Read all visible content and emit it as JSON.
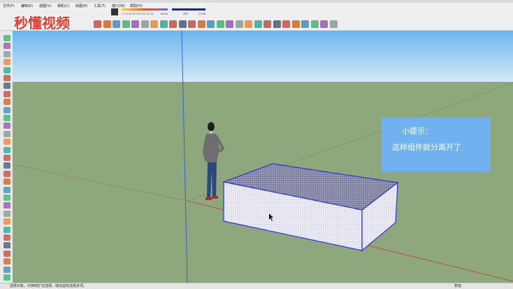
{
  "menu": [
    {
      "label": "文件(F)"
    },
    {
      "label": "编辑(E)"
    },
    {
      "label": "视图(V)"
    },
    {
      "label": "相机(C)"
    },
    {
      "label": "绘图(R)"
    },
    {
      "label": "工具(T)"
    },
    {
      "label": "窗口(W)"
    },
    {
      "label": "帮助(H)"
    }
  ],
  "shadow_bar": {
    "months": "1 2 3 4 5 6 7 8 9 10 11 12",
    "time_start": "06:00",
    "time_mid": "中午",
    "time_end": "17:00"
  },
  "watermark": {
    "text": "秒懂视频"
  },
  "tip": {
    "title": "小提示：",
    "body": "这样组件就分离开了"
  },
  "status": {
    "left": "选择对象。切换到扩充选择。拖动鼠标选择多项。",
    "right": "数值"
  },
  "colors": {
    "sky_top": "#6cb6ec",
    "sky_bottom": "#d4e8f7",
    "ground": "#8fa77c",
    "tip_bg": "#6fb2ef",
    "selection": "#2a31d8"
  },
  "icons": {
    "toolbar": [
      "select-icon",
      "eraser-icon",
      "pencil-icon",
      "rectangle-icon",
      "circle-icon",
      "arc-icon",
      "polygon-icon",
      "pushpull-icon",
      "move-icon",
      "rotate-icon",
      "scale-icon",
      "offset-icon",
      "paint-icon",
      "tape-icon",
      "text-icon",
      "axes-icon",
      "orbit-icon",
      "pan-icon",
      "zoom-icon",
      "zoom-extents-icon",
      "camera-icon",
      "walk-icon",
      "section-icon",
      "component-icon",
      "warehouse-icon",
      "ruby-icon"
    ],
    "left": [
      "select-icon",
      "component-icon",
      "paint-icon",
      "eraser-icon",
      "line-icon",
      "arc-icon",
      "rectangle-icon",
      "circle-icon",
      "polygon-icon",
      "freehand-icon",
      "move-icon",
      "pushpull-icon",
      "rotate-icon",
      "followme-icon",
      "scale-icon",
      "offset-icon",
      "tape-icon",
      "dimension-icon",
      "protractor-icon",
      "text-icon",
      "axes-icon",
      "3dtext-icon",
      "orbit-icon",
      "pan-icon",
      "zoom-icon",
      "zoom-window-icon",
      "zoom-extents-icon",
      "position-camera-icon",
      "walk-icon",
      "lookaround-icon",
      "section-icon"
    ]
  }
}
